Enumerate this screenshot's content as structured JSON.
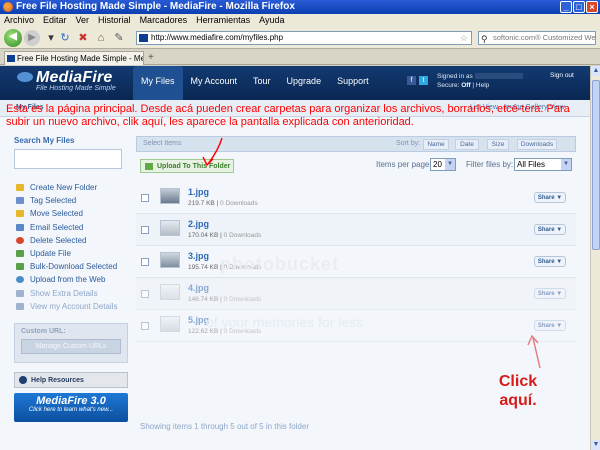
{
  "window": {
    "title": "Free File Hosting Made Simple - MediaFire - Mozilla Firefox",
    "buttons": [
      "_",
      "□",
      "×"
    ]
  },
  "menubar": [
    "Archivo",
    "Editar",
    "Ver",
    "Historial",
    "Marcadores",
    "Herramientas",
    "Ayuda"
  ],
  "navbar": {
    "url": "http://www.mediafire.com/myfiles.php",
    "search_placeholder": "softonic.com® Customized We"
  },
  "tab": {
    "label": "Free File Hosting Made Simple - Medi..."
  },
  "mediafire": {
    "logo": "MediaFire",
    "tagline": "File Hosting Made Simple",
    "nav": [
      "My Files",
      "My Account",
      "Tour",
      "Upgrade",
      "Support"
    ],
    "signed_in_label": "Signed in as",
    "secure_label": "Secure:",
    "secure_value": "Off",
    "help_label": "Help",
    "signout": "Sign out",
    "subbar_title": "My Files",
    "view_options": "List View · Image Gallery View"
  },
  "annotation": {
    "text": "Esta es la página principal. Desde acá pueden crear carpetas para organizar los archivos, borrarlos, etcé-tera. Para subir un nuevo archivo, clik aquí, les aparece la pantalla explicada con anterioridad.",
    "click_here": "Click aquí.",
    "arrow_color": "#ff0000"
  },
  "sidebar": {
    "search_title": "Search My Files",
    "actions": [
      {
        "label": "Create New Folder",
        "icon": "folder-icon",
        "color": "#e8b72b",
        "dim": false
      },
      {
        "label": "Tag Selected",
        "icon": "tag-icon",
        "color": "#6b8fcf",
        "dim": false
      },
      {
        "label": "Move Selected",
        "icon": "move-icon",
        "color": "#e8b72b",
        "dim": false
      },
      {
        "label": "Email Selected",
        "icon": "email-icon",
        "color": "#5b86c7",
        "dim": false
      },
      {
        "label": "Delete Selected",
        "icon": "delete-icon",
        "color": "#d9462b",
        "dim": false
      },
      {
        "label": "Update File",
        "icon": "update-icon",
        "color": "#58a14a",
        "dim": false
      },
      {
        "label": "Bulk-Download Selected",
        "icon": "download-icon",
        "color": "#58a14a",
        "dim": false
      },
      {
        "label": "Upload from the Web",
        "icon": "web-upload-icon",
        "color": "#4a8ec9",
        "dim": false
      },
      {
        "label": "Show Extra Details",
        "icon": "details-icon",
        "color": "#9fb3cf",
        "dim": true
      },
      {
        "label": "View my Account Details",
        "icon": "account-icon",
        "color": "#9fb3cf",
        "dim": true
      }
    ],
    "custom_url_title": "Custom URL:",
    "manage_custom_urls": "Manage Custom URLs",
    "help_resources": "Help Resources",
    "mf3_title": "MediaFire 3.0",
    "mf3_sub": "Click here to learn what's new..."
  },
  "main": {
    "select_items": "Select Items",
    "sort_by": "Sort by:",
    "sort_buttons": [
      "Name",
      "Date",
      "Size",
      "Downloads"
    ],
    "upload_button": "Upload To This Folder",
    "items_per_page_label": "Items per page:",
    "items_per_page_value": "20",
    "filter_label": "Filter files by:",
    "filter_value": "All Files",
    "files": [
      {
        "name": "1.jpg",
        "size": "219.7 KB",
        "downloads": "0 Downloads"
      },
      {
        "name": "2.jpg",
        "size": "170.04 KB",
        "downloads": "0 Downloads"
      },
      {
        "name": "3.jpg",
        "size": "195.74 KB",
        "downloads": "0 Downloads"
      },
      {
        "name": "4.jpg",
        "size": "146.74 KB",
        "downloads": "0 Downloads"
      },
      {
        "name": "5.jpg",
        "size": "122.62 KB",
        "downloads": "0 Downloads"
      }
    ],
    "share_label": "Share ▼",
    "showing": "Showing items 1 through 5 out of 5 in this folder"
  },
  "watermark": {
    "line1": "photobucket",
    "line2": "of your memories for less"
  }
}
